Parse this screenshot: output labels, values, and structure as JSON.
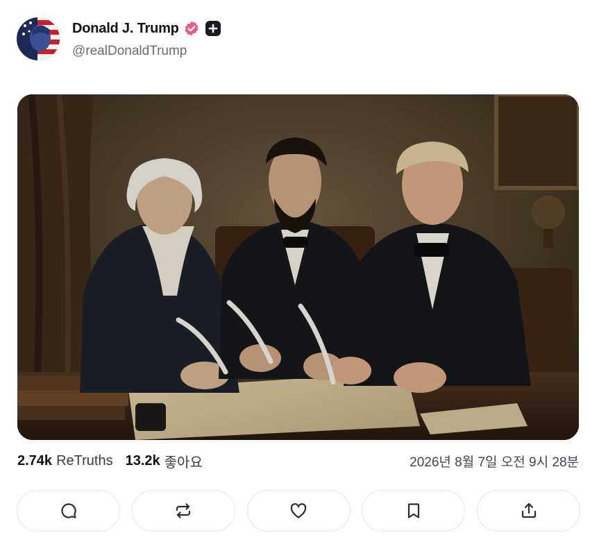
{
  "post": {
    "author": {
      "display_name": "Donald J. Trump",
      "handle": "@realDonaldTrump",
      "verified_icon": "verified-badge-icon",
      "plus_icon": "plus-badge-icon"
    },
    "stats": {
      "retruths_count": "2.74k",
      "retruths_label": "ReTruths",
      "likes_count": "13.2k",
      "likes_label": "좋아요"
    },
    "timestamp": "2026년 8월 7일 오전 9시 28분",
    "actions": [
      {
        "name": "reply",
        "icon": "comment-icon"
      },
      {
        "name": "retruth",
        "icon": "repost-icon"
      },
      {
        "name": "like",
        "icon": "heart-icon"
      },
      {
        "name": "bookmark",
        "icon": "bookmark-icon"
      },
      {
        "name": "share",
        "icon": "share-icon"
      }
    ]
  },
  "colors": {
    "accent_verified": "#e85a8a",
    "text_primary": "#111111",
    "text_secondary": "#6b6b74",
    "button_border": "#e4e4ea"
  }
}
